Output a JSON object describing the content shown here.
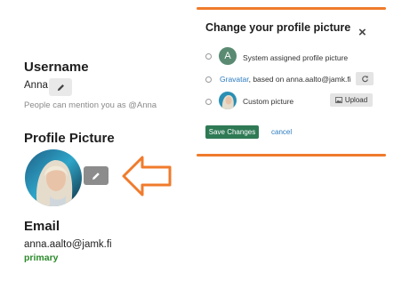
{
  "username": {
    "heading": "Username",
    "value": "Anna",
    "edit_icon": "pencil-icon",
    "mention_hint": "People can mention you as @Anna"
  },
  "profile_picture": {
    "heading": "Profile Picture",
    "edit_icon": "pencil-icon"
  },
  "email": {
    "heading": "Email",
    "value": "anna.aalto@jamk.fi",
    "status": "primary"
  },
  "dialog": {
    "title": "Change your profile picture",
    "close_icon": "close-icon",
    "options": {
      "system": {
        "avatar_letter": "A",
        "label": "System assigned profile picture"
      },
      "gravatar": {
        "link": "Gravatar",
        "label": ", based on anna.aalto@jamk.fi",
        "button_icon": "refresh-icon"
      },
      "custom": {
        "label": "Custom picture",
        "button_label": "Upload",
        "button_icon": "image-icon"
      }
    },
    "save_label": "Save Changes",
    "cancel_label": "cancel"
  },
  "colors": {
    "accent_orange": "#f07b2c",
    "save_green": "#2e7a55",
    "link_blue": "#2b7bbf",
    "primary_green": "#2a8a2a",
    "avatar_letter_bg": "#5a8b72"
  }
}
